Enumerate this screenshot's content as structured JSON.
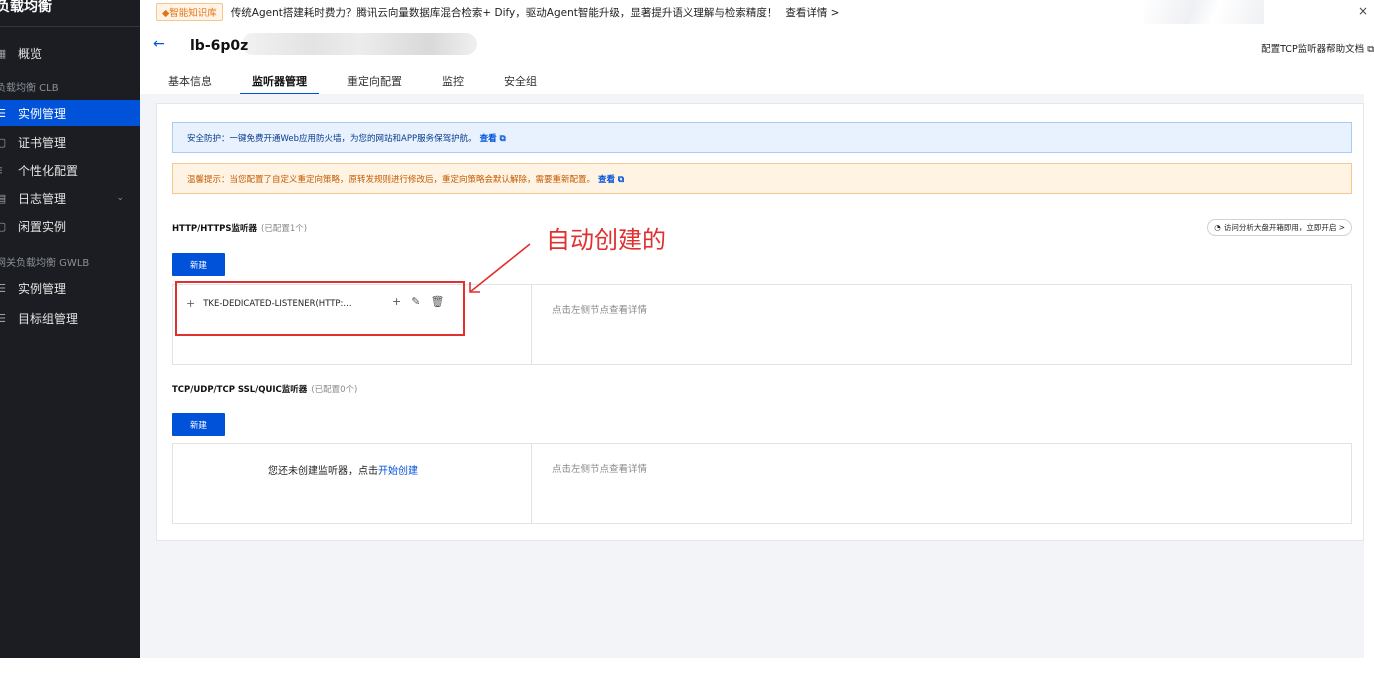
{
  "sidebar": {
    "title": "负载均衡",
    "items": [
      {
        "label": "概览",
        "icon": "grid-icon",
        "active": false
      },
      {
        "label": "实例管理",
        "icon": "list-icon",
        "active": true
      },
      {
        "label": "证书管理",
        "icon": "certificate-icon",
        "active": false
      },
      {
        "label": "个性化配置",
        "icon": "settings-icon",
        "active": false
      },
      {
        "label": "日志管理",
        "icon": "log-icon",
        "active": false
      },
      {
        "label": "闲置实例",
        "icon": "idle-icon",
        "active": false
      },
      {
        "label": "实例管理",
        "icon": "list-icon",
        "active": false
      },
      {
        "label": "目标组管理",
        "icon": "target-group-icon",
        "active": false
      }
    ],
    "groups": [
      "负载均衡 CLB",
      "网关负载均衡 GWLB"
    ]
  },
  "topbar": {
    "badge": "◆智能知识库",
    "notice": "传统Agent搭建耗时费力？腾讯云向量数据库混合检索+ Dify，驱动Agent智能升级，显著提升语义理解与检索精度！",
    "more": "查看详情 >",
    "close": "×"
  },
  "header": {
    "back": "←",
    "title": "lb-6p0z",
    "help": "配置TCP监听器帮助文档",
    "tabs": [
      "基本信息",
      "监听器管理",
      "重定向配置",
      "监控",
      "安全组"
    ],
    "active_tab": 1
  },
  "alerts": {
    "info_text": "安全防护：一键免费开通Web应用防火墙，为您的网站和APP服务保驾护航。",
    "info_link": "查看",
    "warn_text": "温馨提示：当您配置了自定义重定向策略，原转发规则进行修改后，重定向策略会默认解除，需要重新配置。",
    "warn_link": "查看"
  },
  "http_section": {
    "title": "HTTP/HTTPS监听器",
    "count": "(已配置1个)",
    "new_button": "新建",
    "listener_name": "TKE-DEDICATED-LISTENER(HTTP:...",
    "detail_hint": "点击左侧节点查看详情",
    "analysis_pill": "访问分析大盘开箱即用，立即开启 >"
  },
  "tcp_section": {
    "title": "TCP/UDP/TCP SSL/QUIC监听器",
    "count": "(已配置0个)",
    "new_button": "新建",
    "empty_text": "您还未创建监听器，点击",
    "empty_link": "开始创建",
    "detail_hint": "点击左侧节点查看详情"
  },
  "annotation": {
    "text": "自动创建的",
    "color": "#e0302f"
  },
  "colors": {
    "primary": "#0052d9",
    "sidebar_bg": "#1b1d22",
    "annotation_red": "#e0302f"
  }
}
